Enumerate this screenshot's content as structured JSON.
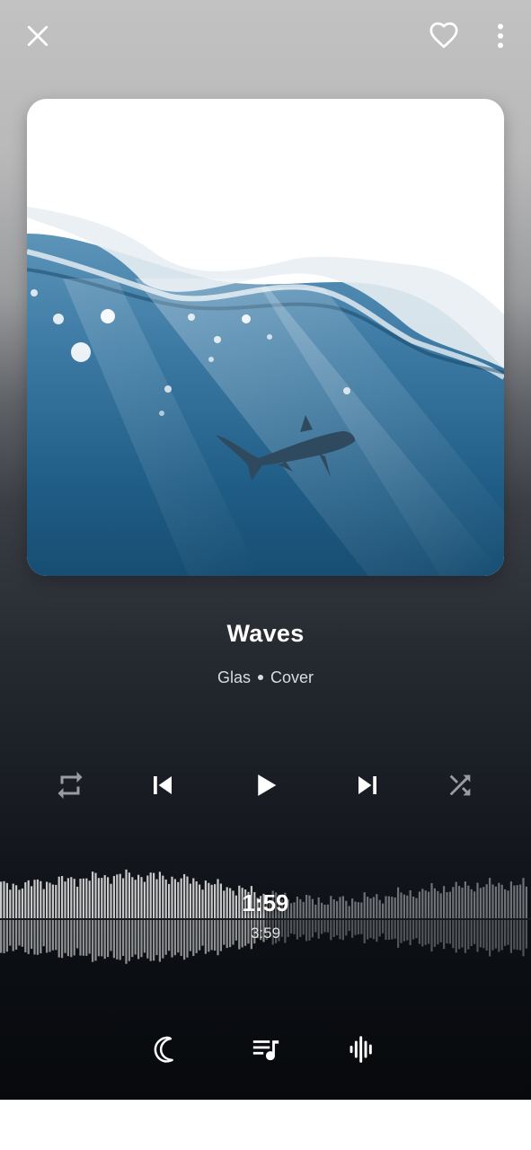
{
  "player": {
    "song_title": "Waves",
    "artist": "Glas",
    "tag": "Cover",
    "elapsed": "1:59",
    "duration": "3:59",
    "progress": 0.497
  },
  "icons": {
    "top_left": "close-icon",
    "top_right": [
      "heart-outline-icon",
      "more-vertical-icon"
    ],
    "controls": [
      "repeat-icon",
      "skip-previous-icon",
      "play-icon",
      "skip-next-icon",
      "shuffle-icon"
    ],
    "bottom": [
      "sleep-timer-moon-icon",
      "queue-music-icon",
      "waveform-icon"
    ]
  },
  "colors": {
    "text_primary": "#ffffff",
    "text_secondary": "#d9dbde",
    "wave_played": "#c9c9c9",
    "wave_unplayed": "#6f7276",
    "inactive_icon": "#9a9ca0"
  }
}
